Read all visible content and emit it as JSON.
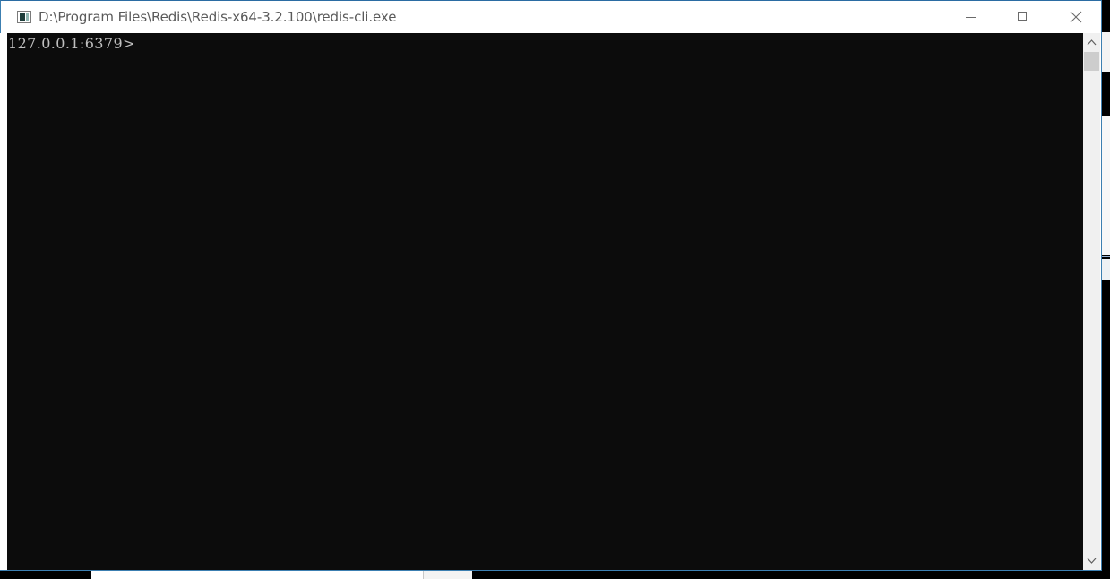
{
  "window": {
    "title": "D:\\Program Files\\Redis\\Redis-x64-3.2.100\\redis-cli.exe",
    "icon": "console-app-icon",
    "controls": {
      "minimize": "minimize-icon",
      "maximize": "maximize-icon",
      "close": "close-icon"
    }
  },
  "console": {
    "prompt": "127.0.0.1:6379>",
    "background": "#0c0c0c",
    "foreground": "#c0c0c0"
  },
  "scrollbar": {
    "up": "chevron-up-icon",
    "down": "chevron-down-icon"
  }
}
